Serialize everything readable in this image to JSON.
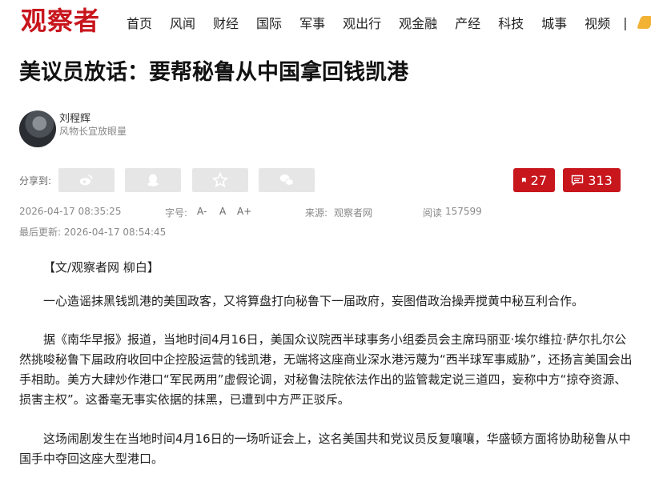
{
  "header": {
    "logo": "观察者",
    "nav": [
      "首页",
      "风闻",
      "财经",
      "国际",
      "军事",
      "观出行",
      "观金融",
      "产经",
      "科技",
      "城事",
      "视频"
    ],
    "separator": "|"
  },
  "article": {
    "title": "美议员放话：要帮秘鲁从中国拿回钱凯港",
    "author": {
      "name": "刘程辉",
      "description": "风物长宜放眼量"
    },
    "share_label": "分享到:",
    "share_icons": [
      "weibo-icon",
      "qq-icon",
      "star-icon",
      "wechat-icon"
    ],
    "bookmark_count": "27",
    "comment_count": "313",
    "publish_time": "2026-04-17 08:35:25",
    "font_label": "字号:",
    "font_small": "A-",
    "font_normal": "A",
    "font_large": "A+",
    "source_label": "来源:",
    "source": "观察者网",
    "views_label": "阅读",
    "views": "157599",
    "updated": "最后更新: 2026-04-17 08:54:45",
    "paragraphs": [
      "【文/观察者网 柳白】",
      "一心造谣抹黑钱凯港的美国政客，又将算盘打向秘鲁下一届政府，妄图借政治操弄搅黄中秘互利合作。",
      "据《南华早报》报道，当地时间4月16日，美国众议院西半球事务小组委员会主席玛丽亚·埃尔维拉·萨尔扎尔公然挑唆秘鲁下届政府收回中企控股运营的钱凯港，无端将这座商业深水港污蔑为“西半球军事威胁”，还扬言美国会出手相助。美方大肆炒作港口“军民两用”虚假论调，对秘鲁法院依法作出的监管裁定说三道四，妄称中方“掠夺资源、损害主权”。这番毫无事实依据的抹黑，已遭到中方严正驳斥。",
      "这场闹剧发生在当地时间4月16日的一场听证会上，这名美国共和党议员反复嚷嚷，华盛顿方面将协助秘鲁从中国手中夺回这座大型港口。"
    ]
  },
  "colors": {
    "brand": "#c8161d",
    "share_bg": "#e6e6e6"
  }
}
